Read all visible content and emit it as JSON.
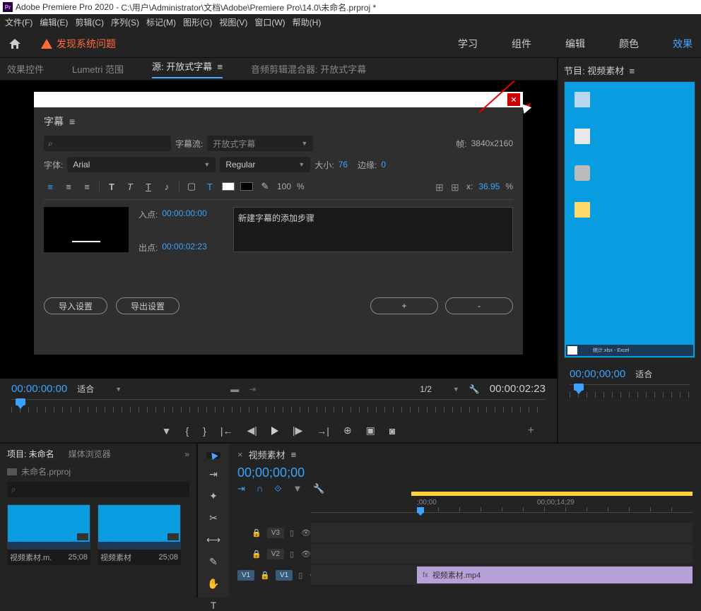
{
  "titlebar": {
    "app": "Adobe Premiere Pro 2020",
    "path": "C:\\用户\\Administrator\\文档\\Adobe\\Premiere Pro\\14.0\\未命名.prproj *",
    "icon": "Pr"
  },
  "menubar": {
    "file": "文件(F)",
    "edit": "编辑(E)",
    "clip": "剪辑(C)",
    "seq": "序列(S)",
    "mark": "标记(M)",
    "gfx": "图形(G)",
    "view": "视图(V)",
    "win": "窗口(W)",
    "help": "帮助(H)"
  },
  "warn": "发现系统问题",
  "topnav": {
    "learn": "学习",
    "assemble": "组件",
    "edit": "编辑",
    "color": "颜色",
    "effects": "效果"
  },
  "panelTabs": {
    "fx": "效果控件",
    "lumetri": "Lumetri 范围",
    "src": "源: 开放式字幕",
    "audio": "音频剪辑混合器: 开放式字幕"
  },
  "caption": {
    "title": "字幕",
    "streamLabel": "字幕流:",
    "streamVal": "开放式字幕",
    "frameLabel": "帧:",
    "frameVal": "3840x2160",
    "fontLabel": "字体:",
    "fontVal": "Arial",
    "weightVal": "Regular",
    "sizeLabel": "大小:",
    "sizeVal": "76",
    "edgeLabel": "边缘:",
    "edgeVal": "0",
    "opacityVal": "100",
    "opacityPct": "%",
    "xVal": "36.95",
    "xPct": "%",
    "xLabel": "x:",
    "inLabel": "入点:",
    "inVal": "00:00:00:00",
    "outLabel": "出点:",
    "outVal": "00:00:02:23",
    "text": "新建字幕的添加步骤",
    "importBtn": "导入设置",
    "exportBtn": "导出设置",
    "plus": "+",
    "minus": "-"
  },
  "transport": {
    "tc": "00:00:00:00",
    "fit": "适合",
    "half": "1/2",
    "dur": "00:00:02:23"
  },
  "program": {
    "title": "节目: 视频素材",
    "tc": "00;00;00;00",
    "fit": "适合",
    "excel": "统计.xlsx - Excel"
  },
  "project": {
    "tab1": "项目: 未命名",
    "tab2": "媒体浏览器",
    "file": "未命名.prproj",
    "clips": [
      {
        "name": "视频素材.m.",
        "dur": "25;08"
      },
      {
        "name": "视频素材",
        "dur": "25;08"
      }
    ]
  },
  "timeline": {
    "seq": "视频素材",
    "tc": "00;00;00;00",
    "t0": ";00;00",
    "t14": "00;00;14;29",
    "v3": "V3",
    "v2": "V2",
    "v1": "V1",
    "v1b": "V1",
    "clipName": "视频素材.mp4",
    "fx": "fx"
  }
}
